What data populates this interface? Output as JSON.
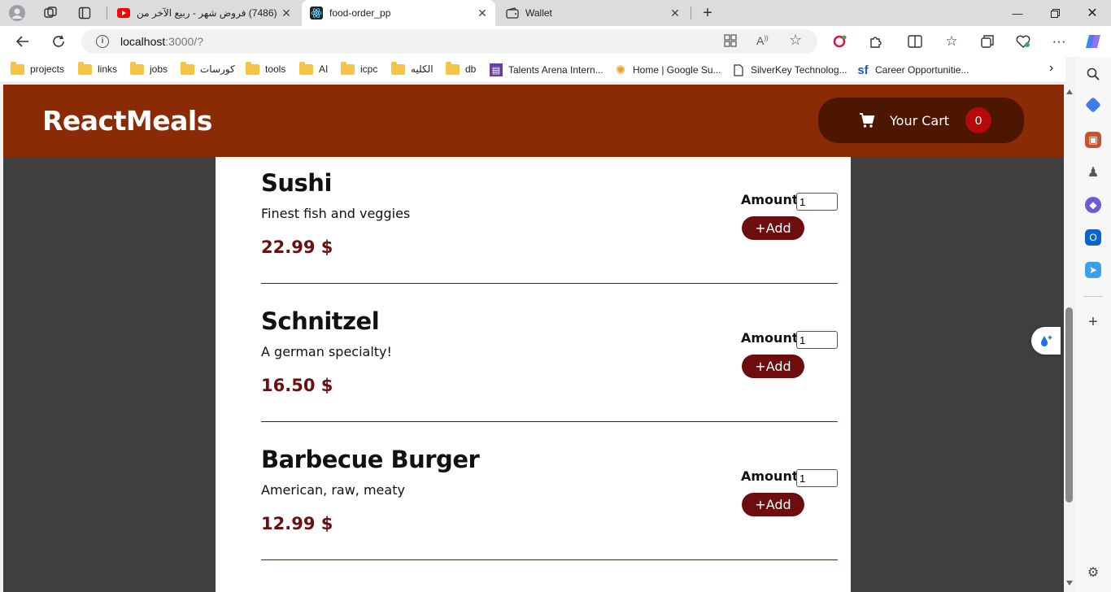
{
  "browser": {
    "tabs": [
      {
        "title": "(7486) فروض شهر - ربيع الآخر من",
        "active": false
      },
      {
        "title": "food-order_pp",
        "active": true
      },
      {
        "title": "Wallet",
        "active": false
      }
    ],
    "url_host": "localhost",
    "url_rest": ":3000/?",
    "bookmarks": [
      "projects",
      "links",
      "jobs",
      "كورسات",
      "tools",
      "AI",
      "icpc",
      "الكليه",
      "db",
      "Talents Arena Intern...",
      "Home | Google Su...",
      "SilverKey Technolog...",
      "Career Opportunitie..."
    ]
  },
  "app": {
    "brand": "ReactMeals",
    "cart_label": "Your Cart",
    "cart_count": "0",
    "amount_label": "Amount",
    "add_label": "+Add",
    "meals": [
      {
        "name": "Sushi",
        "description": "Finest fish and veggies",
        "price": "22.99 $",
        "amount": "1"
      },
      {
        "name": "Schnitzel",
        "description": "A german specialty!",
        "price": "16.50 $",
        "amount": "1"
      },
      {
        "name": "Barbecue Burger",
        "description": "American, raw, meaty",
        "price": "12.99 $",
        "amount": "1"
      }
    ]
  },
  "colors": {
    "header": "#8a2b06",
    "cart_button": "#4d1601",
    "badge": "#b40a0a",
    "add_button": "#6e0d0d",
    "price": "#6a1010",
    "page_bg": "#3f3f3f"
  }
}
